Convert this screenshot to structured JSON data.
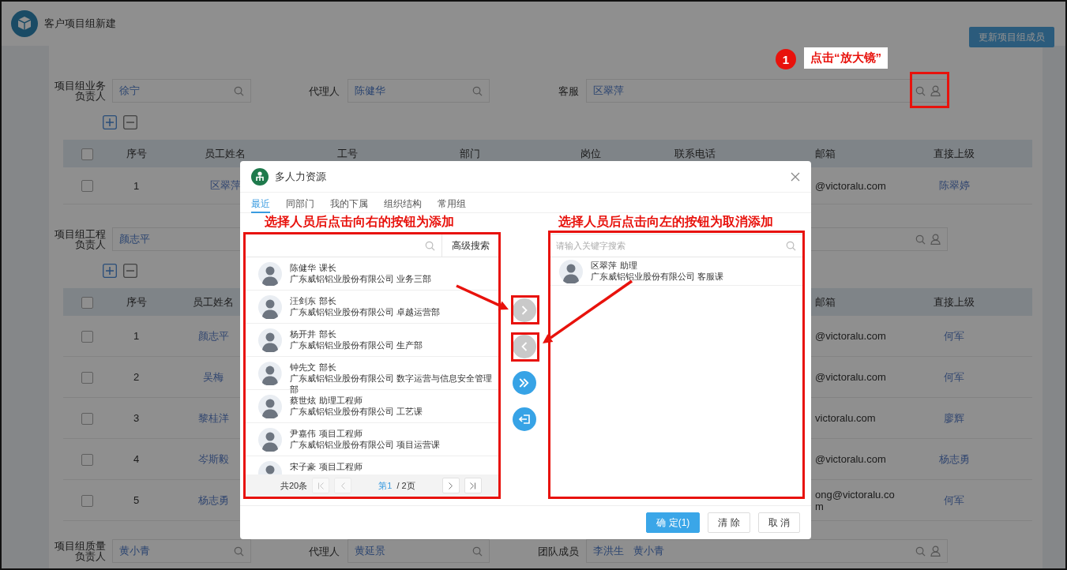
{
  "page": {
    "title": "客户项目组新建",
    "update_button": "更新项目组成员",
    "sections": [
      {
        "fields": [
          {
            "label": "项目组业务负责人",
            "values": [
              "徐宁"
            ],
            "kind": "search"
          },
          {
            "label": "代理人",
            "values": [
              "陈健华"
            ],
            "kind": "search"
          },
          {
            "label": "客服",
            "values": [
              "区翠萍"
            ],
            "kind": "search_person"
          }
        ],
        "table": {
          "all_checked": false,
          "columns": [
            "序号",
            "员工姓名",
            "工号",
            "部门",
            "岗位",
            "联系电话",
            "邮箱",
            "直接上级"
          ],
          "rows": [
            {
              "checked": false,
              "cells": [
                "1",
                "区翠萍",
                "",
                "",
                "",
                "",
                "@victoralu.com",
                "陈翠婷"
              ]
            }
          ]
        }
      },
      {
        "fields": [
          {
            "label": "项目组工程负责人",
            "values": [
              "颜志平"
            ],
            "kind": "search_person"
          }
        ],
        "table": {
          "all_checked": false,
          "columns": [
            "序号",
            "员工姓名",
            "邮箱",
            "直接上级"
          ],
          "rows": [
            {
              "checked": false,
              "cells": [
                "1",
                "颜志平",
                "@victoralu.com",
                "何军"
              ]
            },
            {
              "checked": false,
              "cells": [
                "2",
                "吴梅",
                "@victoralu.com",
                "何军"
              ]
            },
            {
              "checked": false,
              "cells": [
                "3",
                "黎桂洋",
                "victoralu.com",
                "廖辉"
              ]
            },
            {
              "checked": false,
              "cells": [
                "4",
                "岑斯毅",
                "@victoralu.com",
                "杨志勇"
              ]
            },
            {
              "checked": false,
              "cells": [
                "5",
                "杨志勇",
                "ong@victoralu.com",
                "何军"
              ]
            }
          ]
        }
      },
      {
        "fields": [
          {
            "label": "项目组质量负责人",
            "values": [
              "黄小青"
            ],
            "kind": "search"
          },
          {
            "label": "代理人",
            "values": [
              "黄延景"
            ],
            "kind": "search"
          },
          {
            "label": "团队成员",
            "values": [
              "李洪生",
              "黄小青"
            ],
            "kind": "search_person"
          }
        ]
      }
    ]
  },
  "modal": {
    "title": "多人力资源",
    "tabs": [
      {
        "label": "最近",
        "selected": true
      },
      {
        "label": "同部门",
        "selected": false
      },
      {
        "label": "我的下属",
        "selected": false
      },
      {
        "label": "组织结构",
        "selected": false
      },
      {
        "label": "常用组",
        "selected": false
      }
    ],
    "left": {
      "advanced_button": "高级搜索",
      "people": [
        {
          "name": "陈健华",
          "title": "课长",
          "org": "广东威铝铝业股份有限公司 业务三部"
        },
        {
          "name": "汪剑东",
          "title": "部长",
          "org": "广东威铝铝业股份有限公司 卓越运营部"
        },
        {
          "name": "杨开井",
          "title": "部长",
          "org": "广东威铝铝业股份有限公司 生产部"
        },
        {
          "name": "钟先文",
          "title": "部长",
          "org": "广东威铝铝业股份有限公司 数字运营与信息安全管理部"
        },
        {
          "name": "蔡世炫",
          "title": "助理工程师",
          "org": "广东威铝铝业股份有限公司 工艺课"
        },
        {
          "name": "尹嘉伟",
          "title": "项目工程师",
          "org": "广东威铝铝业股份有限公司 项目运营课"
        },
        {
          "name": "宋子豪",
          "title": "项目工程师"
        }
      ],
      "pager": {
        "total": "共20条",
        "current": "第1",
        "pages": "/ 2页",
        "buttons": [
          {
            "kind": "first",
            "disabled": true
          },
          {
            "kind": "prev",
            "disabled": true
          },
          {
            "kind": "next",
            "disabled": false
          },
          {
            "kind": "last",
            "disabled": false
          }
        ]
      }
    },
    "transfer_buttons": [
      {
        "kind": "add",
        "disabled": true
      },
      {
        "kind": "remove",
        "disabled": true
      },
      {
        "kind": "add_all",
        "disabled": false
      },
      {
        "kind": "remove_all",
        "disabled": false
      }
    ],
    "right": {
      "placeholder": "请输入关键字搜索",
      "people": [
        {
          "name": "区翠萍",
          "title": "助理",
          "org": "广东威铝铝业股份有限公司 客服课"
        }
      ]
    },
    "footer_buttons": [
      {
        "label": "确 定(1)",
        "kind": "primary"
      },
      {
        "label": "清 除",
        "kind": "default"
      },
      {
        "label": "取 消",
        "kind": "default"
      }
    ]
  },
  "annotations": {
    "step": "1",
    "step_note": "点击“放大镜”",
    "left_note": "选择人员后点击向右的按钮为添加",
    "right_note": "选择人员后点击向左的按钮为取消添加"
  }
}
